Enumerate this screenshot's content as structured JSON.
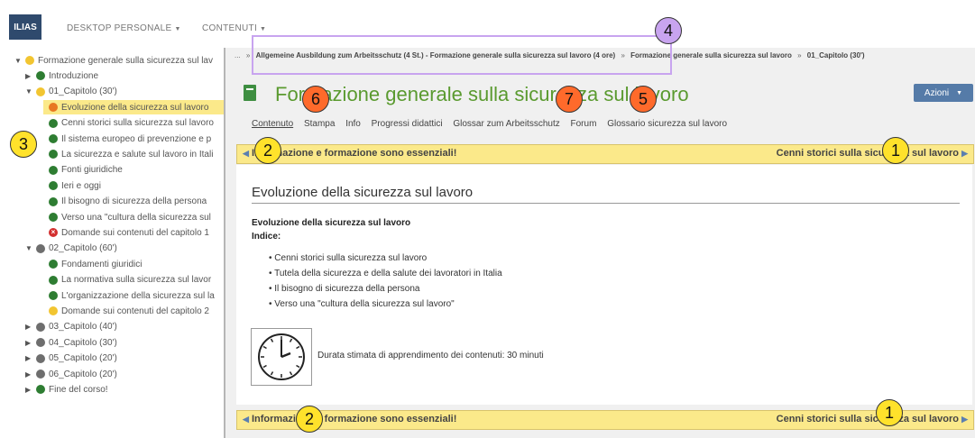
{
  "top": {
    "logo": "ILIAS",
    "nav": [
      "DESKTOP PERSONALE",
      "CONTENUTI"
    ]
  },
  "tree": [
    {
      "label": "Formazione generale sulla sicurezza sul lav",
      "dot": "y",
      "toggle": "▼",
      "indent": 0
    },
    {
      "label": "Introduzione",
      "dot": "g",
      "toggle": "▶",
      "indent": 1
    },
    {
      "label": "01_Capitolo (30')",
      "dot": "y",
      "toggle": "▼",
      "indent": 1
    },
    {
      "label": "Evoluzione della sicurezza sul lavoro",
      "dot": "o",
      "toggle": "",
      "indent": 2,
      "hl": true
    },
    {
      "label": "Cenni storici sulla sicurezza sul lavoro",
      "dot": "g",
      "toggle": "",
      "indent": 2
    },
    {
      "label": "Il sistema europeo di prevenzione e p",
      "dot": "g",
      "toggle": "",
      "indent": 2
    },
    {
      "label": "La sicurezza e salute sul lavoro in Itali",
      "dot": "g",
      "toggle": "",
      "indent": 2
    },
    {
      "label": "Fonti giuridiche",
      "dot": "g",
      "toggle": "",
      "indent": 2
    },
    {
      "label": "Ieri e oggi",
      "dot": "g",
      "toggle": "",
      "indent": 2
    },
    {
      "label": "Il bisogno di sicurezza della persona",
      "dot": "g",
      "toggle": "",
      "indent": 2
    },
    {
      "label": "Verso una \"cultura della sicurezza sul",
      "dot": "g",
      "toggle": "",
      "indent": 2
    },
    {
      "label": "Domande sui contenuti del capitolo 1",
      "dot": "x",
      "toggle": "",
      "indent": 2
    },
    {
      "label": "02_Capitolo (60')",
      "dot": "gr",
      "toggle": "▼",
      "indent": 1
    },
    {
      "label": "Fondamenti giuridici",
      "dot": "g",
      "toggle": "",
      "indent": 2
    },
    {
      "label": "La normativa sulla sicurezza sul lavor",
      "dot": "g",
      "toggle": "",
      "indent": 2
    },
    {
      "label": "L'organizzazione della sicurezza sul la",
      "dot": "g",
      "toggle": "",
      "indent": 2
    },
    {
      "label": "Domande sui contenuti del capitolo 2",
      "dot": "y",
      "toggle": "",
      "indent": 2
    },
    {
      "label": "03_Capitolo (40')",
      "dot": "gr",
      "toggle": "▶",
      "indent": 1
    },
    {
      "label": "04_Capitolo (30')",
      "dot": "gr",
      "toggle": "▶",
      "indent": 1
    },
    {
      "label": "05_Capitolo (20')",
      "dot": "gr",
      "toggle": "▶",
      "indent": 1
    },
    {
      "label": "06_Capitolo (20')",
      "dot": "gr",
      "toggle": "▶",
      "indent": 1
    },
    {
      "label": "Fine del corso!",
      "dot": "g",
      "toggle": "▶",
      "indent": 1
    }
  ],
  "breadcrumb": {
    "ellipsis": "...",
    "item1": "Allgemeine Ausbildung zum Arbeitsschutz (4 St.) - Formazione generale sulla sicurezza sul lavoro (4 ore)",
    "item2": "Formazione generale sulla sicurezza sul lavoro",
    "item3": "01_Capitolo (30')"
  },
  "page_title": "Formazione generale sulla sicurezza sul lavoro",
  "actions_label": "Azioni",
  "tabs": [
    "Contenuto",
    "Stampa",
    "Info",
    "Progressi didattici",
    "Glossar zum Arbeitsschutz",
    "Forum",
    "Glossario sicurezza sul lavoro"
  ],
  "nav": {
    "prev": "Informazione e formazione sono essenziali!",
    "next": "Cenni storici sulla sicurezza sul lavoro"
  },
  "content": {
    "heading": "Evoluzione della sicurezza sul lavoro",
    "bold_title": "Evoluzione della sicurezza sul lavoro",
    "index_label": "Indice:",
    "bullets": [
      "Cenni storici sulla sicurezza sul lavoro",
      "Tutela della sicurezza e della salute dei lavoratori in Italia",
      "Il bisogno di sicurezza della persona",
      "Verso una \"cultura della sicurezza sul lavoro\""
    ],
    "duration": "Durata stimata di apprendimento dei contenuti: 30 minuti"
  },
  "callouts": [
    "1",
    "2",
    "3",
    "4",
    "5",
    "6",
    "7"
  ]
}
